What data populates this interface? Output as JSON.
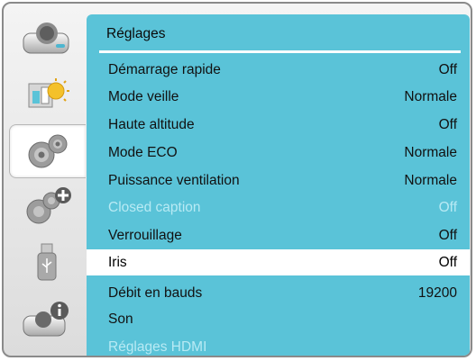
{
  "panel": {
    "title": "Réglages"
  },
  "tabs": [
    {
      "icon": "projector-icon",
      "active": false
    },
    {
      "icon": "image-adjust-icon",
      "active": false
    },
    {
      "icon": "gears-icon",
      "active": true
    },
    {
      "icon": "gears-plus-icon",
      "active": false
    },
    {
      "icon": "usb-drive-icon",
      "active": false
    },
    {
      "icon": "projector-info-icon",
      "active": false
    }
  ],
  "rows": [
    {
      "label": "Démarrage rapide",
      "value": "Off"
    },
    {
      "label": "Mode veille",
      "value": "Normale"
    },
    {
      "label": "Haute altitude",
      "value": "Off"
    },
    {
      "label": "Mode ECO",
      "value": "Normale"
    },
    {
      "label": "Puissance ventilation",
      "value": "Normale"
    },
    {
      "label": "Closed caption",
      "value": "Off",
      "disabled": true
    },
    {
      "label": "Verrouillage",
      "value": "Off"
    },
    {
      "label": "Iris",
      "value": "Off",
      "selected": true
    },
    {
      "label": "Débit en bauds",
      "value": "19200"
    },
    {
      "label": "Son",
      "value": ""
    },
    {
      "label": "Réglages HDMI",
      "value": "",
      "disabled": true
    }
  ],
  "colors": {
    "panel": "#5ac3d8",
    "selected_row": "#ffffff",
    "disabled_text": "#b8eaf4"
  }
}
